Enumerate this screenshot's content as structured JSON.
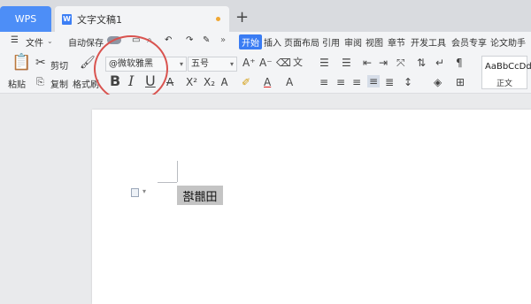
{
  "titlebar": {
    "app_tab": "WPS",
    "doc_tab_icon": "W",
    "doc_tab_title": "文字文稿1",
    "new_tab": "+"
  },
  "menubar": {
    "file_label": "文件",
    "autosave_label": "自动保存",
    "more": "»",
    "tabs": [
      "开始",
      "插入",
      "页面布局",
      "引用",
      "审阅",
      "视图",
      "章节",
      "开发工具",
      "会员专享",
      "论文助手"
    ]
  },
  "ribbon": {
    "cut_label": "剪切",
    "paste_label": "粘贴",
    "copy_label": "复制",
    "format_painter_label": "格式刷",
    "font_name": "@微软雅黑",
    "font_size": "五号",
    "bold": "B",
    "italic": "I",
    "underline": "U",
    "style_preview": "AaBbCcDd",
    "style_name": "正文"
  },
  "document": {
    "selected_text": "田腊塔"
  },
  "colors": {
    "accent": "#3a7cf3",
    "wps_tab": "#4d8ef7",
    "highlight_circle": "#d9534f",
    "selection": "#c4c4c4"
  }
}
